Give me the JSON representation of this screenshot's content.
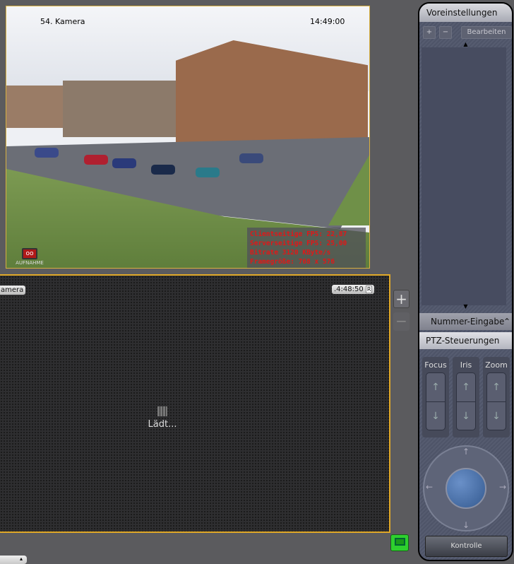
{
  "camera1": {
    "name": "54. Kamera",
    "time": "14:49:00",
    "stats": [
      "Clientseitige FPS: 22,87",
      "Serverseitige FPS: 25,00",
      "Bitrate 3120 KByte/s",
      "Framegröße: 768 x 576"
    ],
    "record_label": "AUFNAHME"
  },
  "camera2": {
    "name": "amera",
    "time": ".4:48:50",
    "time_badge": "R",
    "loading": "Lädt..."
  },
  "side": {
    "zoom_in": "+",
    "zoom_out": "−"
  },
  "panel": {
    "title": "Voreinstellungen",
    "add": "+",
    "remove": "−",
    "edit": "Bearbeiten",
    "number_input": "Nummer-Eingabe",
    "ptz": "PTZ-Steuerungen",
    "controls": [
      "Focus",
      "Iris",
      "Zoom"
    ],
    "control_button": "Kontrolle"
  },
  "colors": {
    "accent": "#e0a828",
    "status_green": "#2ed02e",
    "stats_red": "#e01818"
  }
}
